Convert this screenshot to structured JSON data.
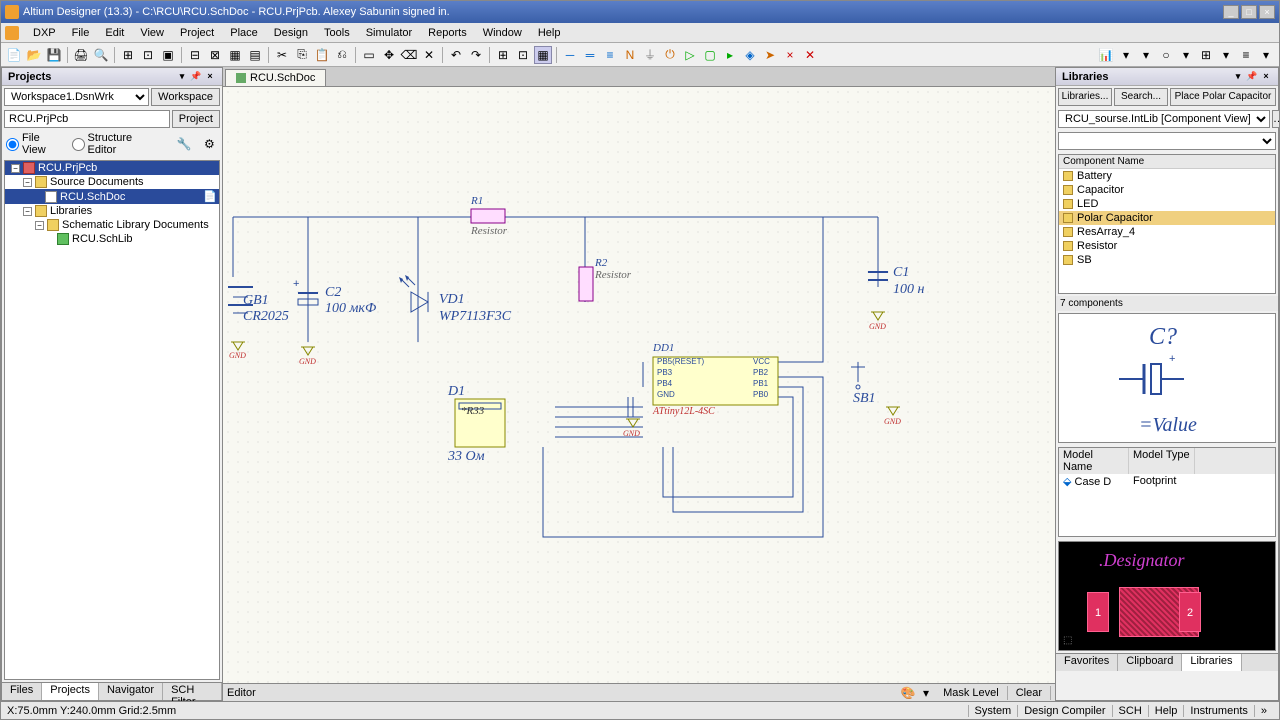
{
  "title": "Altium Designer (13.3) - C:\\RCU\\RCU.SchDoc - RCU.PrjPcb. Alexey Sabunin signed in.",
  "menu": {
    "dxp": "DXP",
    "file": "File",
    "edit": "Edit",
    "view": "View",
    "project": "Project",
    "place": "Place",
    "design": "Design",
    "tools": "Tools",
    "simulator": "Simulator",
    "reports": "Reports",
    "window": "Window",
    "help": "Help"
  },
  "projects": {
    "title": "Projects",
    "workspace": "Workspace1.DsnWrk",
    "workspace_btn": "Workspace",
    "project": "RCU.PrjPcb",
    "project_btn": "Project",
    "view_file": "File View",
    "view_struct": "Structure Editor",
    "tree": {
      "root": "RCU.PrjPcb",
      "src": "Source Documents",
      "schdoc": "RCU.SchDoc",
      "libs": "Libraries",
      "schlibdocs": "Schematic Library Documents",
      "schlib": "RCU.SchLib"
    }
  },
  "doc_tab": "RCU.SchDoc",
  "schematic": {
    "gb1": "GB1",
    "gb1_val": "CR2025",
    "c2": "C2",
    "c2_val": "100 мкФ",
    "vd1": "VD1",
    "vd1_val": "WP7113F3C",
    "r1": "R1",
    "r1_val": "Resistor",
    "r2": "R2",
    "r2_val": "Resistor",
    "d1": "D1",
    "d1_val": "*R33",
    "d1_bot": "33 Ом",
    "dd1": "DD1",
    "dd1_val": "ATtiny12L-4SC",
    "dd1_pins_l": [
      "PB5(RESET)",
      "PB3",
      "PB4",
      "GND"
    ],
    "dd1_pins_r": [
      "VCC",
      "PB2",
      "PB1",
      "PB0"
    ],
    "c1": "C1",
    "c1_val": "100 н",
    "sb1": "SB1",
    "gnd": "GND"
  },
  "libraries": {
    "title": "Libraries",
    "btn_libs": "Libraries...",
    "btn_search": "Search...",
    "btn_place": "Place Polar Capacitor",
    "selected_lib": "RCU_sourse.IntLib [Component View]",
    "filter": "",
    "col_name": "Component Name",
    "items": [
      "Battery",
      "Capacitor",
      "LED",
      "Polar Capacitor",
      "ResArray_4",
      "Resistor",
      "SB"
    ],
    "count": "7 components",
    "preview_des": "C?",
    "preview_val": "=Value",
    "model_name_hdr": "Model Name",
    "model_type_hdr": "Model Type",
    "model_name": "Case D",
    "model_type": "Footprint",
    "fp_designator": ".Designator",
    "fp_pad1": "1",
    "fp_pad2": "2"
  },
  "bottom_tabs_left": [
    "Files",
    "Projects",
    "Navigator",
    "SCH Filter"
  ],
  "editor_label": "Editor",
  "bottom_right": {
    "mask": "Mask Level",
    "clear": "Clear"
  },
  "bottom_tabs_right": [
    "Favorites",
    "Clipboard",
    "Libraries"
  ],
  "status": {
    "coords": "X:75.0mm Y:240.0mm    Grid:2.5mm",
    "items": [
      "System",
      "Design Compiler",
      "SCH",
      "Help",
      "Instruments"
    ]
  }
}
